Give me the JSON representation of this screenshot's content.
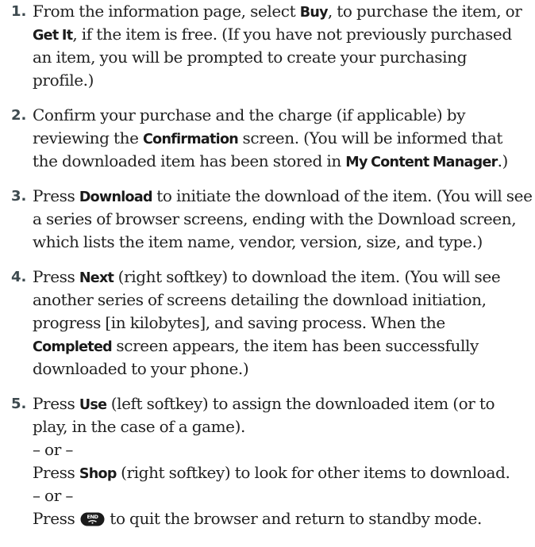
{
  "steps": [
    {
      "number": "1.",
      "lines": [
        [
          {
            "t": "From the information page, select "
          },
          {
            "t": "Buy",
            "b": true
          },
          {
            "t": ", to purchase the item, or"
          }
        ],
        [
          {
            "t": "Get It",
            "b": true
          },
          {
            "t": ", if the item is free. (If you have not previously purchased"
          }
        ],
        [
          {
            "t": "an item, you will be prompted to create your purchasing"
          }
        ],
        [
          {
            "t": "profile.)"
          }
        ]
      ]
    },
    {
      "number": "2.",
      "lines": [
        [
          {
            "t": "Confirm your purchase and the charge (if applicable) by"
          }
        ],
        [
          {
            "t": "reviewing the "
          },
          {
            "t": "Confirmation",
            "b": true
          },
          {
            "t": " screen. (You will be informed that"
          }
        ],
        [
          {
            "t": "the downloaded item has been stored in "
          },
          {
            "t": "My Content Manager",
            "b": true
          },
          {
            "t": ".)"
          }
        ]
      ]
    },
    {
      "number": "3.",
      "lines": [
        [
          {
            "t": "Press "
          },
          {
            "t": "Download",
            "b": true
          },
          {
            "t": " to initiate the download of the item. (You will see"
          }
        ],
        [
          {
            "t": "a series of browser screens, ending with the Download screen,"
          }
        ],
        [
          {
            "t": "which lists the item name, vendor, version, size, and type.)"
          }
        ]
      ]
    },
    {
      "number": "4.",
      "lines": [
        [
          {
            "t": "Press "
          },
          {
            "t": "Next",
            "b": true
          },
          {
            "t": " (right softkey) to download the item. (You will see"
          }
        ],
        [
          {
            "t": "another series of screens detailing the download initiation,"
          }
        ],
        [
          {
            "t": "progress [in kilobytes], and saving process. When the"
          }
        ],
        [
          {
            "t": "Completed",
            "b": true
          },
          {
            "t": " screen appears, the item has been successfully"
          }
        ],
        [
          {
            "t": "downloaded to your phone.)"
          }
        ]
      ]
    },
    {
      "number": "5.",
      "lines": [
        [
          {
            "t": "Press "
          },
          {
            "t": "Use",
            "b": true
          },
          {
            "t": " (left softkey) to assign the downloaded item (or to"
          }
        ],
        [
          {
            "t": "play, in the case of a game)."
          }
        ],
        [
          {
            "t": "– or –"
          }
        ],
        [
          {
            "t": "Press "
          },
          {
            "t": "Shop",
            "b": true
          },
          {
            "t": " (right softkey) to look for other items to download."
          }
        ],
        [
          {
            "t": "– or –"
          }
        ],
        [
          {
            "t": "Press "
          },
          {
            "icon": "end-key-icon",
            "label": "END"
          },
          {
            "t": " to quit the browser and return to standby mode."
          }
        ]
      ]
    }
  ]
}
